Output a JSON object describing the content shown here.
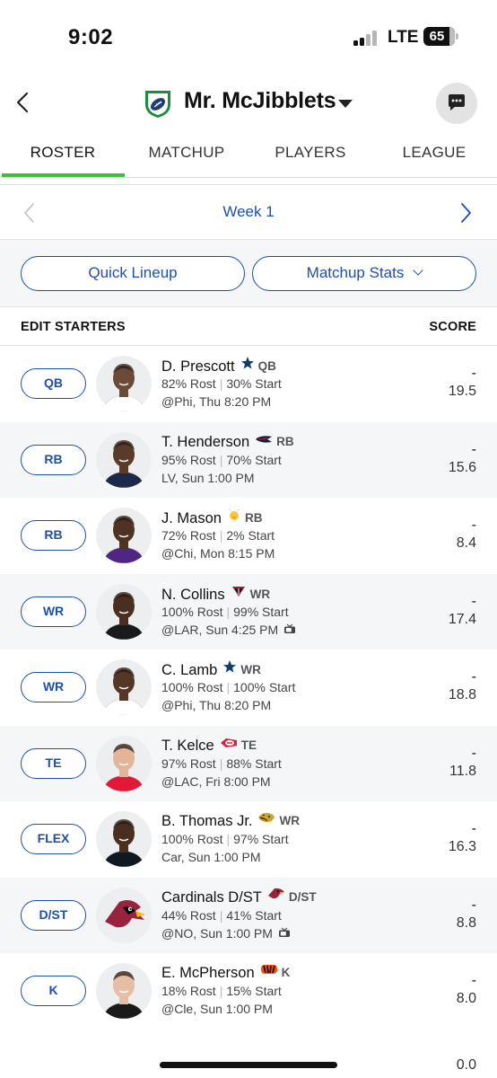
{
  "status_bar": {
    "time": "9:02",
    "network": "LTE",
    "battery": "65"
  },
  "header": {
    "team_name": "Mr. McJibblets"
  },
  "tabs": [
    {
      "label": "ROSTER",
      "active": true
    },
    {
      "label": "MATCHUP",
      "active": false
    },
    {
      "label": "PLAYERS",
      "active": false
    },
    {
      "label": "LEAGUE",
      "active": false
    }
  ],
  "week": {
    "label": "Week 1"
  },
  "actions": {
    "quick_lineup": "Quick Lineup",
    "matchup_stats": "Matchup Stats"
  },
  "list_header": {
    "left": "EDIT STARTERS",
    "right": "SCORE"
  },
  "roster": [
    {
      "slot": "QB",
      "name": "D. Prescott",
      "team_icon": "cowboys-star-icon",
      "pos": "QB",
      "rost": "82% Rost",
      "start": "30% Start",
      "game": "@Phi,  Thu 8:20 PM",
      "tv": false,
      "score_top": "-",
      "score": "19.5",
      "skin": "#6b4a37",
      "jersey": "#ffffff"
    },
    {
      "slot": "RB",
      "name": "T. Henderson",
      "team_icon": "patriots-icon",
      "pos": "RB",
      "rost": "95% Rost",
      "start": "70% Start",
      "game": "LV,  Sun 1:00 PM",
      "tv": false,
      "score_top": "-",
      "score": "15.6",
      "skin": "#5a3a28",
      "jersey": "#1b2a4a"
    },
    {
      "slot": "RB",
      "name": "J. Mason",
      "team_icon": "vikings-icon",
      "pos": "RB",
      "rost": "72% Rost",
      "start": "2% Start",
      "game": "@Chi,  Mon 8:15 PM",
      "tv": false,
      "score_top": "-",
      "score": "8.4",
      "skin": "#4e3222",
      "jersey": "#4f2683"
    },
    {
      "slot": "WR",
      "name": "N. Collins",
      "team_icon": "texans-icon",
      "pos": "WR",
      "rost": "100% Rost",
      "start": "99% Start",
      "game": "@LAR,  Sun 4:25 PM",
      "tv": true,
      "score_top": "-",
      "score": "17.4",
      "skin": "#4a2f21",
      "jersey": "#1a1a1a"
    },
    {
      "slot": "WR",
      "name": "C. Lamb",
      "team_icon": "cowboys-star-icon",
      "pos": "WR",
      "rost": "100% Rost",
      "start": "100% Start",
      "game": "@Phi,  Thu 8:20 PM",
      "tv": false,
      "score_top": "-",
      "score": "18.8",
      "skin": "#553726",
      "jersey": "#ffffff"
    },
    {
      "slot": "TE",
      "name": "T. Kelce",
      "team_icon": "chiefs-icon",
      "pos": "TE",
      "rost": "97% Rost",
      "start": "88% Start",
      "game": "@LAC,  Fri 8:00 PM",
      "tv": false,
      "score_top": "-",
      "score": "11.8",
      "skin": "#e2b49a",
      "jersey": "#e31837"
    },
    {
      "slot": "FLEX",
      "name": "B. Thomas Jr.",
      "team_icon": "jaguars-icon",
      "pos": "WR",
      "rost": "100% Rost",
      "start": "97% Start",
      "game": "Car,  Sun 1:00 PM",
      "tv": false,
      "score_top": "-",
      "score": "16.3",
      "skin": "#4a2f21",
      "jersey": "#101820"
    },
    {
      "slot": "D/ST",
      "name": "Cardinals D/ST",
      "team_icon": "cardinals-icon",
      "pos": "D/ST",
      "rost": "44% Rost",
      "start": "41% Start",
      "game": "@NO,  Sun 1:00 PM",
      "tv": true,
      "score_top": "-",
      "score": "8.8",
      "skin": "",
      "jersey": ""
    },
    {
      "slot": "K",
      "name": "E. McPherson",
      "team_icon": "bengals-icon",
      "pos": "K",
      "rost": "18% Rost",
      "start": "15% Start",
      "game": "@Cle,  Sun 1:00 PM",
      "tv": false,
      "score_top": "-",
      "score": "8.0",
      "skin": "#e6bea6",
      "jersey": "#1a1a1a"
    }
  ],
  "bench_score": "0.0",
  "colors": {
    "accent_blue": "#1f4fa8",
    "tab_green": "#3cbf3a"
  }
}
